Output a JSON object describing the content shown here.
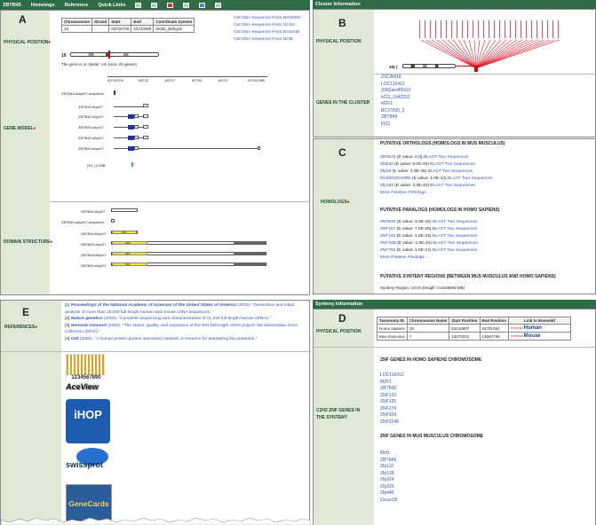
{
  "nav": {
    "title": "ZBTB45",
    "items": [
      "Homologs",
      "Reference",
      "Quick Links"
    ]
  },
  "panelA": {
    "letter": "A",
    "physical_position": "PHYSICAL POSITION",
    "table_headers": [
      "Chromosome",
      "Strand",
      "Start",
      "End",
      "Coordinate System"
    ],
    "table_row": [
      "19",
      "-",
      "63716709",
      "63742089",
      "NCBI_36/hg18"
    ],
    "links": [
      "Get DNA Sequence From BIOSINO",
      "Get DNA Sequence From UCSC",
      "Get DNA Sequence From Ensembl",
      "Get DNA Sequence From NCBI"
    ],
    "chrom": "19",
    "cluster_prefix": "The gene is in cluster ",
    "cluster_num": "166",
    "cluster_suffix": " (size: 29 genes).",
    "gene_model": "GENE MODEL",
    "scale": [
      "63716709",
      "63722",
      "63727",
      "63732",
      "63737",
      "63742,089"
    ],
    "tracks": [
      "ZBTB45.aAprl07-unspliced",
      "ZBTB45.fApr07",
      "ZBTB45.bApr07",
      "ZBTB45.cApr07",
      "ZBTB45.dApr07",
      "ZBTB45.eApr07",
      "HG_U133B"
    ],
    "domain_structure": "DOMAIN STRUCTURE",
    "domain_tracks": [
      "ZBTB45.fApr07",
      "ZBTB45.aAprl07-unspliced",
      "ZBTB45.bApr07",
      "ZBTB45.cApr07",
      "ZBTB45.dApr07",
      "ZBTB45.eApr07"
    ],
    "domain_label": "ZF8"
  },
  "panelB": {
    "header": "Cluster Information",
    "letter": "B",
    "physical_position": "PHYSICAL POSITION",
    "chrom_label": "19(-)",
    "cluster_genes": [
      "ZSCAN18",
      "LOC116412",
      "ZIM2andPEG3",
      "hCG_2042202",
      "MZF1",
      "BC37295_3",
      "ZBTB45",
      "FIZ1"
    ],
    "genes_label": "GENES IN THE CLUSTER"
  },
  "panelC": {
    "letter": "C",
    "homologs": "HOMOLOGS",
    "orth_title": "PUTATIVE ORTHOLOGS (HOMOLOGS IN MUS MUSCULUS)",
    "orthologs": [
      {
        "name": "ZBTB45",
        "e": "(E value: 0.0)",
        "blast": "BLAST Two Sequences"
      },
      {
        "name": "Zbtb20",
        "e": "(E value: 9.0E-46)",
        "blast": "BLAST Two Sequences"
      },
      {
        "name": "Zfp28",
        "e": "(E value: 4.0E-25)",
        "blast": "BLAST Two Sequences"
      },
      {
        "name": "9130019O22Rik",
        "e": "(E value: 1.0E-24)",
        "blast": "BLAST Two Sequences"
      },
      {
        "name": "Zfp182",
        "e": "(E value: 2.0E-24)",
        "blast": "BLAST Two Sequences"
      }
    ],
    "more_orth": "More Putative Orthologs ...",
    "para_title": "PUTATIVE PARALOGS (HOMOLOGS IN HOMO SAPIENS)",
    "paralogs": [
      {
        "name": "ZBTB20",
        "e": "(E value: 5.0E-46)",
        "blast": "BLAST Two Sequences"
      },
      {
        "name": "ZNF157",
        "e": "(E value: 7.0E-25)",
        "blast": "BLAST Two Sequences"
      },
      {
        "name": "ZNF182",
        "e": "(E value: 1.0E-24)",
        "blast": "BLAST Two Sequences"
      },
      {
        "name": "ZNF33B",
        "e": "(E value: 1.0E-24)",
        "blast": "BLAST Two Sequences"
      },
      {
        "name": "ZNF782",
        "e": "(E value: 1.0E-24)",
        "blast": "BLAST Two Sequences"
      }
    ],
    "more_para": "More Putative Paralogs ...",
    "synteny_title": "PUTATIVE SYNTENY REGIONS (BETWEEN MUS MUSCULUS AND HOMO SAPIENS)",
    "synteny_prefix": "Synteny Region: ",
    "synteny_num": "33025",
    "synteny_suffix": " (length: 0.4636605 MB)"
  },
  "panelD": {
    "header": "Synteny Information",
    "letter": "D",
    "physical_position": "PHYSICAL POSITION",
    "table_headers": [
      "Taxonomy ID",
      "Chromosome Name",
      "Start Position",
      "End Position",
      "Link to Ensembl"
    ],
    "rows": [
      [
        "Homo sapiens",
        "19",
        "63216607",
        "63781364",
        "Human"
      ],
      [
        "Mus musculus",
        "7",
        "13279231",
        "13640795",
        "Mouse"
      ]
    ],
    "c2h2_label": "C2H2 ZNF GENES IN THE SYNTENY",
    "hs_title": "ZNF GENES IN HOMO SAPIENS CHROMOSOME",
    "hs_genes": [
      "LOC116412",
      "MZF1",
      "ZBTB45",
      "ZNF132",
      "ZNF135",
      "ZNF274",
      "ZNF324",
      "ZNF3248"
    ],
    "mm_title": "ZNF GENES IN MUS MUSCULUS CHROMOSOME",
    "mm_genes": [
      "Mzf1",
      "ZBTB45",
      "Zfp110",
      "Zfp128",
      "Zfp324",
      "Zfp329",
      "Zfp446",
      "Zscan18"
    ]
  },
  "panelE": {
    "letter": "E",
    "references": "REFERENCES",
    "refs": [
      {
        "n": "[1]",
        "j": "Proceedings of the National Academy of Sciences of the United States of America",
        "t": "(2002). \"Generation and initial analysis of more than 15,000 full-length human and mouse cDNA sequences.\""
      },
      {
        "n": "[2]",
        "j": "Nature genetics",
        "t": "(2004). \"Complete sequencing and characterization of 21,243 full-length human cDNAs.\""
      },
      {
        "n": "[3]",
        "j": "Genome research",
        "t": "(2004). \"The status, quality, and expansion of the NIH full-length cDNA project: the Mammalian Gene Collection (MGC).\""
      },
      {
        "n": "[4]",
        "j": "Cell",
        "t": "(2005). \"A human protein-protein interaction network: a resource for annotating the proteome.\""
      }
    ],
    "logos": {
      "barcode": "1234567890",
      "aceview": "AceView",
      "ihop": "iHOP",
      "swissprot": "swissprot",
      "genecards": "GeneCards"
    }
  }
}
